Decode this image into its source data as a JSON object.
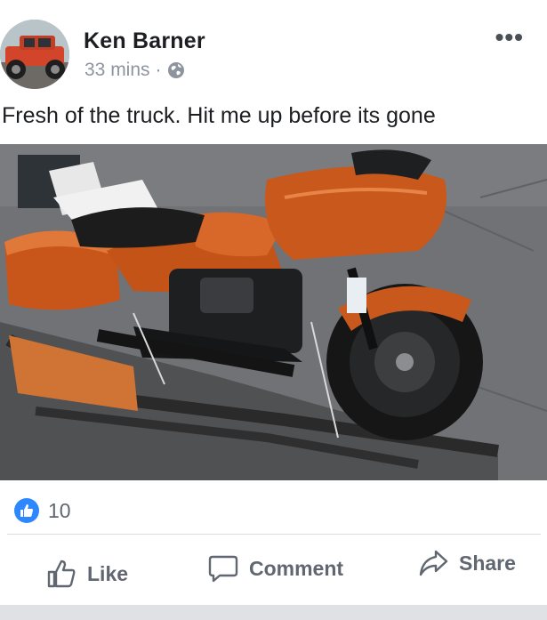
{
  "post": {
    "author": "Ken Barner",
    "time": "33 mins",
    "separator": "·",
    "privacy_icon": "globe-icon",
    "text": "Fresh of the truck. Hit me up before its gone"
  },
  "reactions": {
    "icon": "thumbs-up-icon",
    "count": "10"
  },
  "actions": {
    "like": "Like",
    "comment": "Comment",
    "share": "Share"
  },
  "colors": {
    "like_blue": "#2d88ff",
    "motorcycle_orange": "#c8561b"
  }
}
